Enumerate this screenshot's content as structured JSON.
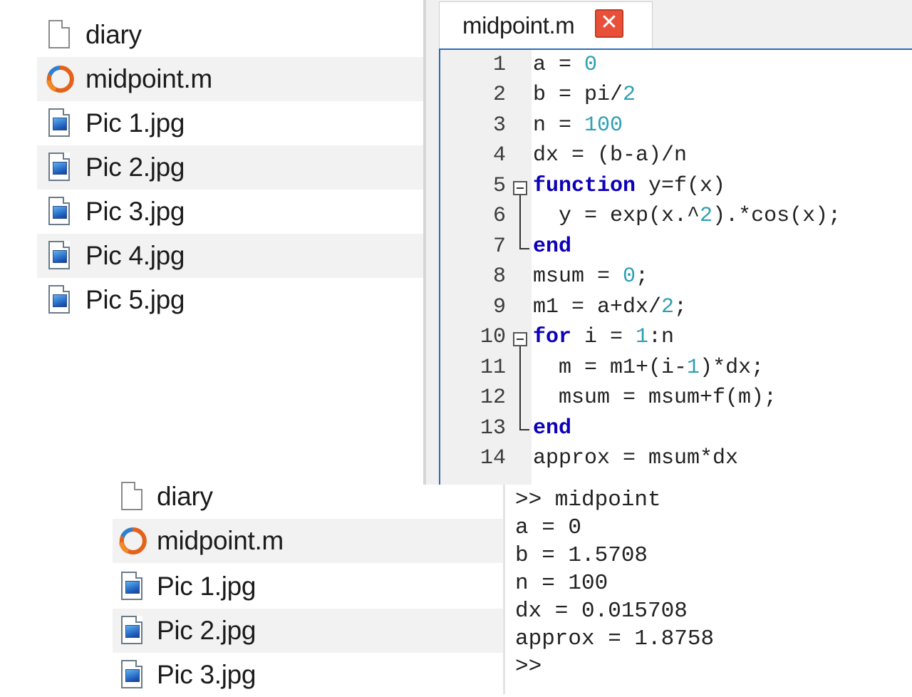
{
  "top_browser": {
    "files": [
      {
        "name": "diary",
        "icon": "file-icon"
      },
      {
        "name": "midpoint.m",
        "icon": "matlab-file-icon"
      },
      {
        "name": "Pic 1.jpg",
        "icon": "image-file-icon"
      },
      {
        "name": "Pic 2.jpg",
        "icon": "image-file-icon"
      },
      {
        "name": "Pic 3.jpg",
        "icon": "image-file-icon"
      },
      {
        "name": "Pic 4.jpg",
        "icon": "image-file-icon"
      },
      {
        "name": "Pic 5.jpg",
        "icon": "image-file-icon"
      }
    ]
  },
  "editor": {
    "tab_label": "midpoint.m",
    "close_glyph": "✕",
    "line_numbers": [
      "1",
      "2",
      "3",
      "4",
      "5",
      "6",
      "7",
      "8",
      "9",
      "10",
      "11",
      "12",
      "13",
      "14"
    ],
    "lines": [
      "a = 0",
      "b = pi/2",
      "n = 100",
      "dx = (b-a)/n",
      "function y=f(x)",
      "  y = exp(x.^2).*cos(x);",
      "end",
      "msum = 0;",
      "m1 = a+dx/2;",
      "for i = 1:n",
      "  m = m1+(i-1)*dx;",
      "  msum = msum+f(m);",
      "end",
      "approx = msum*dx"
    ],
    "keyword_color": "#0e00b9",
    "number_color": "#2e9fb4"
  },
  "bottom_browser": {
    "files": [
      {
        "name": "diary",
        "icon": "file-icon"
      },
      {
        "name": "midpoint.m",
        "icon": "matlab-file-icon"
      },
      {
        "name": "Pic 1.jpg",
        "icon": "image-file-icon"
      },
      {
        "name": "Pic 2.jpg",
        "icon": "image-file-icon"
      },
      {
        "name": "Pic 3.jpg",
        "icon": "image-file-icon"
      }
    ]
  },
  "console": {
    "lines": [
      ">> midpoint",
      "a = 0",
      "b = 1.5708",
      "n = 100",
      "dx = 0.015708",
      "approx = 1.8758",
      ">>"
    ]
  }
}
